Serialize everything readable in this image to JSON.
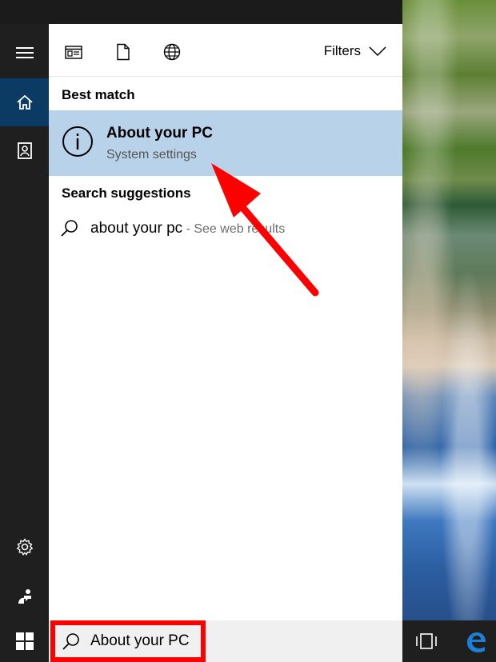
{
  "toolbar": {
    "filters_label": "Filters",
    "icons": [
      "apps-icon",
      "document-icon",
      "web-icon"
    ]
  },
  "best_match": {
    "section_title": "Best match",
    "title": "About your PC",
    "subtitle": "System settings",
    "icon": "info-icon"
  },
  "suggestions": {
    "section_title": "Search suggestions",
    "items": [
      {
        "query": "about your pc",
        "extra": " - See web results"
      }
    ]
  },
  "taskbar": {
    "search_value": "About your PC"
  },
  "colors": {
    "accent_selected": "#b8d2ea",
    "rail_active": "#0b3a63",
    "annotation": "#ff0000"
  }
}
